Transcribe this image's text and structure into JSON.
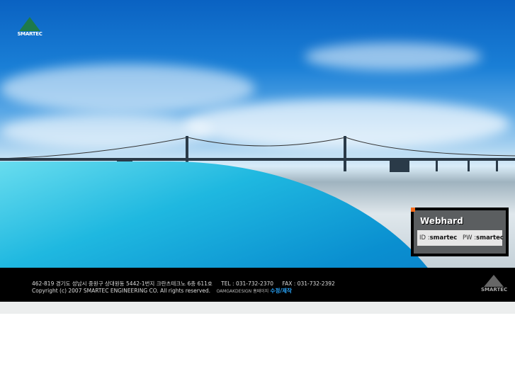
{
  "logo": {
    "text": "SMARTEC"
  },
  "webhard": {
    "title": "Webhard",
    "id_label": "ID :",
    "id_value": "smartec",
    "pw_label": "PW :",
    "pw_value": "smartec"
  },
  "footer": {
    "address": "462-819 경기도 성남시 중원구 상대원동 5442-1번지 크란츠테크노 6층 611호",
    "tel": "TEL : 031-732-2370",
    "fax": "FAX : 031-732-2392",
    "copyright": "Copyright (c) 2007 SMARTEC ENGINEERING CO. All rights reserved.",
    "designer": "OAMGAKDESIGN 홈페이지",
    "design_link": "수정/제작",
    "logo_text": "SMARTEC"
  },
  "colors": {
    "footer_bg": "#000000",
    "link": "#2aa8ff",
    "accent": "#f26a1b"
  }
}
